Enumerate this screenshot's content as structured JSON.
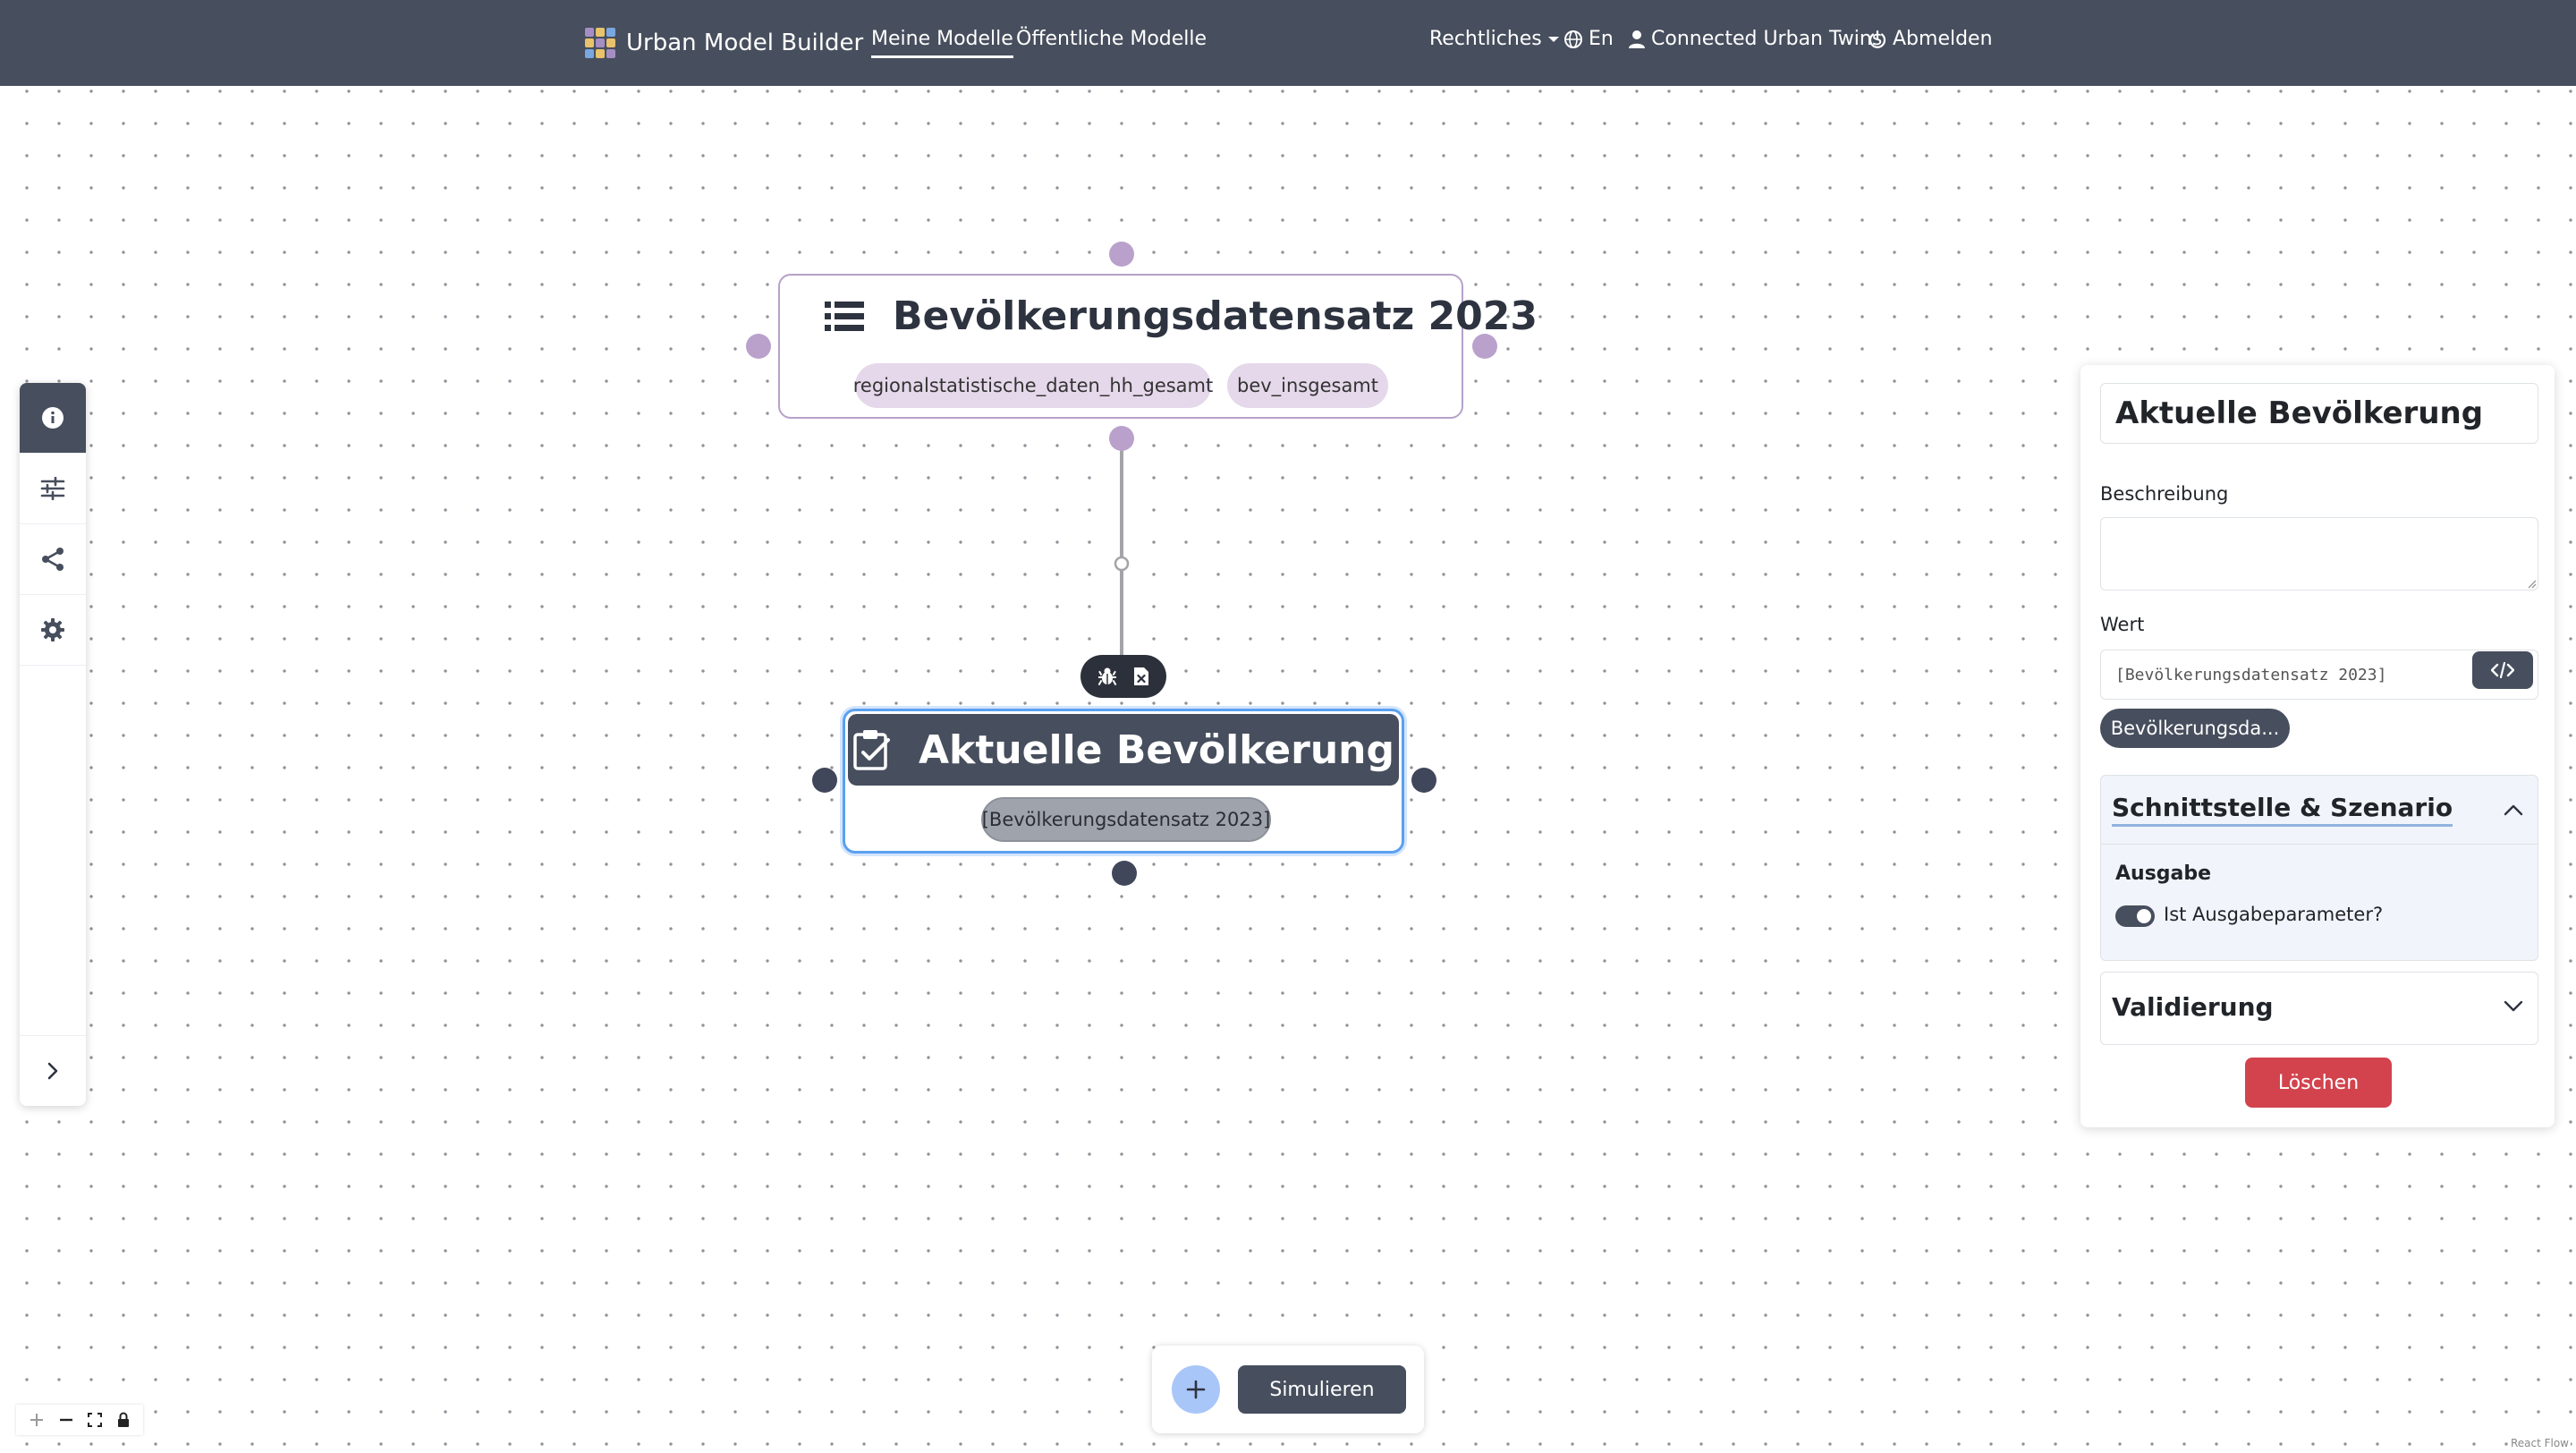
{
  "navbar": {
    "brand": "Urban Model Builder",
    "links": [
      "Meine Modelle",
      "Öffentliche Modelle"
    ],
    "legal": "Rechtliches",
    "language": "En",
    "user": "Connected Urban Twins",
    "logout": "Abmelden"
  },
  "sidebar": {
    "items": [
      "info-icon",
      "sliders-icon",
      "share-icon",
      "gear-icon"
    ],
    "expand": "chevron-right-icon"
  },
  "nodes": {
    "source": {
      "title": "Bevölkerungsdatensatz 2023",
      "tags": [
        "regionalstatistische_daten_hh_gesamt",
        "bev_insgesamt"
      ]
    },
    "selected": {
      "title": "Aktuelle Bevölkerung",
      "value": "[Bevölkerungsdatensatz 2023]"
    }
  },
  "panel": {
    "name": "Aktuelle Bevölkerung",
    "description_label": "Beschreibung",
    "description_value": "",
    "value_label": "Wert",
    "value": "[Bevölkerungsdatensatz 2023]",
    "reference_pill": "Bevölkerungsda...",
    "section_interface": "Schnittstelle & Szenario",
    "output_label": "Ausgabe",
    "output_toggle_label": "Ist Ausgabeparameter?",
    "output_toggle_on": true,
    "section_validation": "Validierung",
    "delete_button": "Löschen"
  },
  "bottom": {
    "simulate_button": "Simulieren"
  },
  "attribution": "React Flow",
  "colors": {
    "navbar": "#474e5d",
    "accent_purple": "#b9a1cc",
    "selection_blue": "#5aa0f0",
    "delete_red": "#d2434e"
  }
}
